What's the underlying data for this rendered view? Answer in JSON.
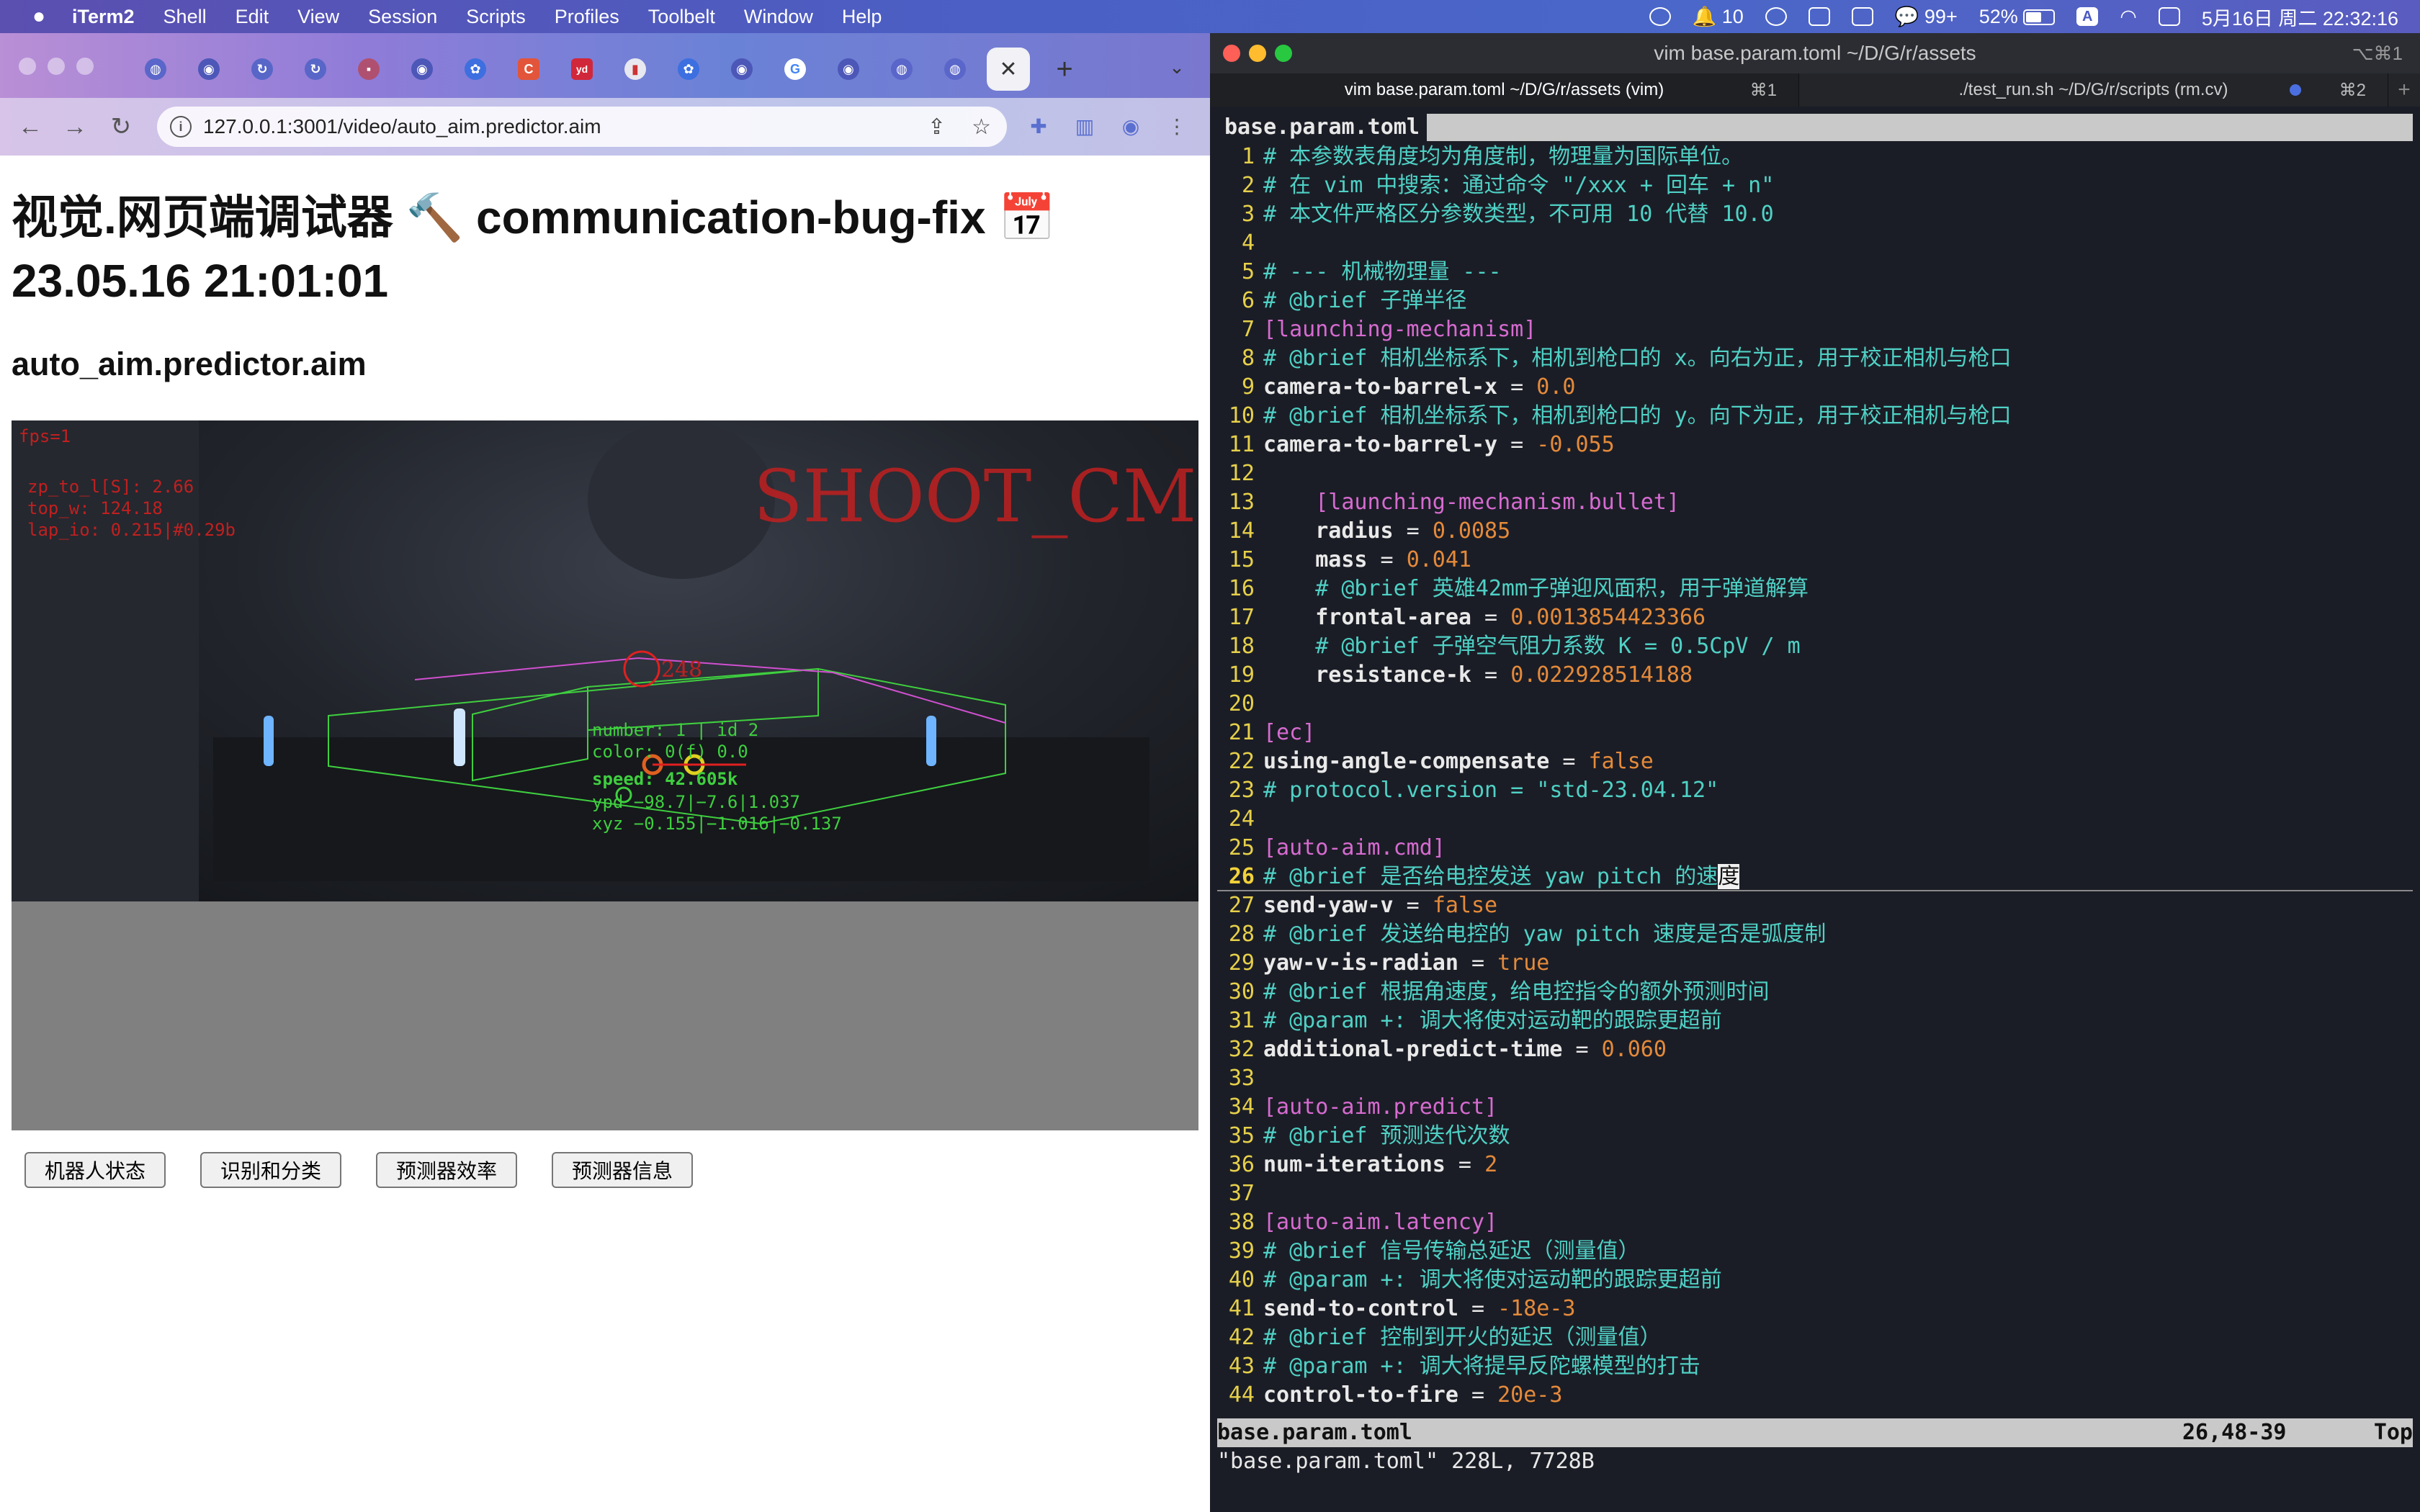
{
  "menubar": {
    "app_name": "iTerm2",
    "menus": [
      "Shell",
      "Edit",
      "View",
      "Session",
      "Scripts",
      "Profiles",
      "Toolbelt",
      "Window",
      "Help"
    ],
    "status": {
      "notifications": "10",
      "wechat": "99+",
      "battery": "52%",
      "input_method": "A",
      "datetime": "5月16日 周二 22:32:16"
    }
  },
  "browser": {
    "url": "127.0.0.1:3001/video/auto_aim.predictor.aim",
    "page": {
      "title": "视觉.网页端调试器 🔨 communication-bug-fix 📅 23.05.16 21:01:01",
      "subtitle": "auto_aim.predictor.aim",
      "buttons": [
        "机器人状态",
        "识别和分类",
        "预测器效率",
        "预测器信息"
      ]
    },
    "overlay": {
      "fps": "fps=1",
      "lines": [
        "zp_to_l[S]: 2.66",
        "top_w: 124.18",
        "lap_io: 0.215|#0.29b"
      ],
      "shoot": "SHOOT_CMD",
      "target_id": "248",
      "info": [
        "number: 1 | id 2",
        "color: 0(f) 0.0"
      ],
      "speed": "speed: 42.605k",
      "ypd": "ypd −98.7|−7.6|1.037",
      "xyz": "xyz −0.155|−1.016|−0.137"
    }
  },
  "terminal": {
    "window_title": "vim base.param.toml  ~/D/G/r/assets",
    "window_shortcut": "⌥⌘1",
    "tabs": [
      {
        "label": "vim base.param.toml  ~/D/G/r/assets (vim)",
        "key": "⌘1"
      },
      {
        "label": "./test_run.sh ~/D/G/r/scripts (rm.cv)",
        "key": "⌘2"
      }
    ],
    "vim_tab": "base.param.toml",
    "status_file": "base.param.toml",
    "status_pos": "26,48-39",
    "status_pct": "Top",
    "message": "\"base.param.toml\" 228L, 7728B"
  },
  "lines": [
    {
      "n": "1",
      "ind": "",
      "t": "comment",
      "text": "# 本参数表角度均为角度制，物理量为国际单位。"
    },
    {
      "n": "2",
      "ind": "",
      "t": "comment",
      "text": "# 在 vim 中搜索：通过命令 \"/xxx + 回车 + n\""
    },
    {
      "n": "3",
      "ind": "",
      "t": "comment",
      "text": "# 本文件严格区分参数类型，不可用 10 代替 10.0"
    },
    {
      "n": "4",
      "ind": "",
      "t": "blank"
    },
    {
      "n": "5",
      "ind": "",
      "t": "comment",
      "text": "# --- 机械物理量 ---"
    },
    {
      "n": "6",
      "ind": "",
      "t": "comment",
      "text": "# @brief 子弹半径"
    },
    {
      "n": "7",
      "ind": "",
      "t": "section",
      "text": "[launching-mechanism]"
    },
    {
      "n": "8",
      "ind": "",
      "t": "comment",
      "text": "# @brief 相机坐标系下，相机到枪口的 x。向右为正，用于校正相机与枪口"
    },
    {
      "n": "9",
      "ind": "",
      "t": "kv",
      "key": "camera-to-barrel-x",
      "val": "0.0"
    },
    {
      "n": "10",
      "ind": "",
      "t": "comment",
      "text": "# @brief 相机坐标系下，相机到枪口的 y。向下为正，用于校正相机与枪口"
    },
    {
      "n": "11",
      "ind": "",
      "t": "kv",
      "key": "camera-to-barrel-y",
      "val": "-0.055"
    },
    {
      "n": "12",
      "ind": "",
      "t": "blank"
    },
    {
      "n": "13",
      "ind": "    ",
      "t": "section",
      "text": "[launching-mechanism.bullet]"
    },
    {
      "n": "14",
      "ind": "    ",
      "t": "kv",
      "key": "radius",
      "val": "0.0085"
    },
    {
      "n": "15",
      "ind": "    ",
      "t": "kv",
      "key": "mass",
      "val": "0.041"
    },
    {
      "n": "16",
      "ind": "    ",
      "t": "comment",
      "text": "# @brief 英雄42mm子弹迎风面积，用于弹道解算"
    },
    {
      "n": "17",
      "ind": "    ",
      "t": "kv",
      "key": "frontal-area",
      "val": "0.0013854423366"
    },
    {
      "n": "18",
      "ind": "    ",
      "t": "comment",
      "text": "# @brief 子弹空气阻力系数 K = 0.5CpV / m"
    },
    {
      "n": "19",
      "ind": "    ",
      "t": "kv",
      "key": "resistance-k",
      "val": "0.022928514188"
    },
    {
      "n": "20",
      "ind": "",
      "t": "blank"
    },
    {
      "n": "21",
      "ind": "",
      "t": "section",
      "text": "[ec]"
    },
    {
      "n": "22",
      "ind": "",
      "t": "kv",
      "key": "using-angle-compensate",
      "val": "false"
    },
    {
      "n": "23",
      "ind": "",
      "t": "comment",
      "text": "# protocol.version = \"std-23.04.12\""
    },
    {
      "n": "24",
      "ind": "",
      "t": "blank"
    },
    {
      "n": "25",
      "ind": "",
      "t": "section",
      "text": "[auto-aim.cmd]"
    },
    {
      "n": "26",
      "ind": "",
      "t": "comment",
      "text": "# @brief 是否给电控发送 yaw pitch 的速",
      "cursor": "度"
    },
    {
      "n": "27",
      "ind": "",
      "t": "kv",
      "key": "send-yaw-v",
      "val": "false"
    },
    {
      "n": "28",
      "ind": "",
      "t": "comment",
      "text": "# @brief 发送给电控的 yaw pitch 速度是否是弧度制"
    },
    {
      "n": "29",
      "ind": "",
      "t": "kv",
      "key": "yaw-v-is-radian",
      "val": "true"
    },
    {
      "n": "30",
      "ind": "",
      "t": "comment",
      "text": "# @brief 根据角速度，给电控指令的额外预测时间"
    },
    {
      "n": "31",
      "ind": "",
      "t": "comment",
      "text": "# @param +: 调大将使对运动靶的跟踪更超前"
    },
    {
      "n": "32",
      "ind": "",
      "t": "kv",
      "key": "additional-predict-time",
      "val": "0.060"
    },
    {
      "n": "33",
      "ind": "",
      "t": "blank"
    },
    {
      "n": "34",
      "ind": "",
      "t": "section",
      "text": "[auto-aim.predict]"
    },
    {
      "n": "35",
      "ind": "",
      "t": "comment",
      "text": "# @brief 预测迭代次数"
    },
    {
      "n": "36",
      "ind": "",
      "t": "kv",
      "key": "num-iterations",
      "val": "2"
    },
    {
      "n": "37",
      "ind": "",
      "t": "blank"
    },
    {
      "n": "38",
      "ind": "",
      "t": "section",
      "text": "[auto-aim.latency]"
    },
    {
      "n": "39",
      "ind": "",
      "t": "comment",
      "text": "# @brief 信号传输总延迟（测量值）"
    },
    {
      "n": "40",
      "ind": "",
      "t": "comment",
      "text": "# @param +: 调大将使对运动靶的跟踪更超前"
    },
    {
      "n": "41",
      "ind": "",
      "t": "kv",
      "key": "send-to-control",
      "val": "-18e-3"
    },
    {
      "n": "42",
      "ind": "",
      "t": "comment",
      "text": "# @brief 控制到开火的延迟（测量值）"
    },
    {
      "n": "43",
      "ind": "",
      "t": "comment",
      "text": "# @param +: 调大将提早反陀螺模型的打击"
    },
    {
      "n": "44",
      "ind": "",
      "t": "kv",
      "key": "control-to-fire",
      "val": "20e-3"
    }
  ]
}
